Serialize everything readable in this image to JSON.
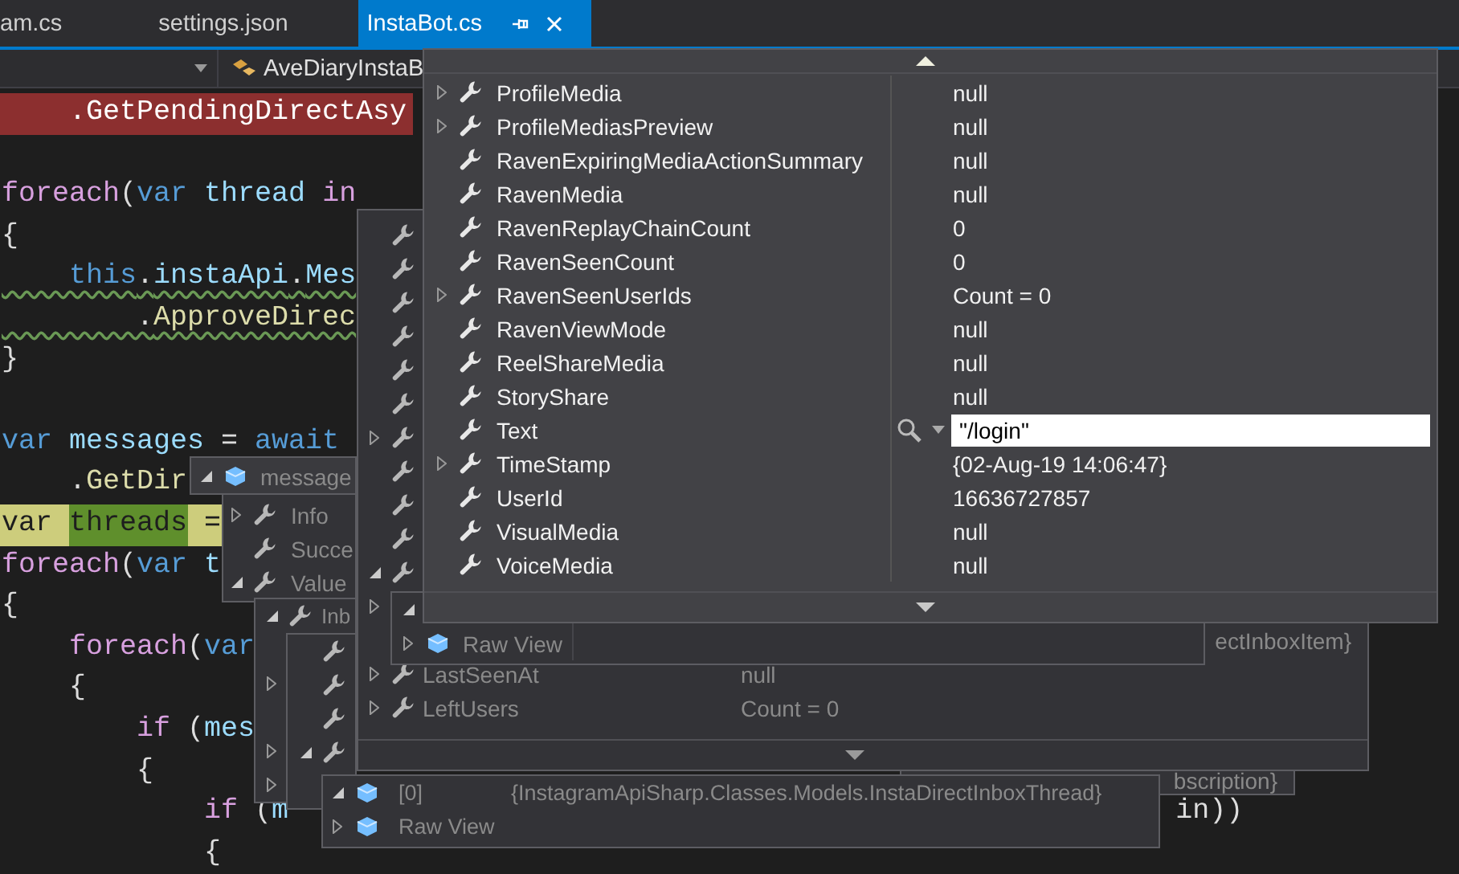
{
  "tabs": [
    {
      "label": "am.cs",
      "selected": false
    },
    {
      "label": "settings.json",
      "selected": false
    },
    {
      "label": "InstaBot.cs",
      "selected": true
    }
  ],
  "nav": {
    "member": "AveDiaryInstaB"
  },
  "code": [
    {
      "breakpoint": true,
      "current": false,
      "squiggle": false,
      "tokens": [
        {
          "text": "    .",
          "kind": "p"
        },
        {
          "text": "GetPendingDirectAsy",
          "kind": "fn"
        }
      ]
    },
    {
      "breakpoint": false,
      "current": false
    },
    {
      "breakpoint": false,
      "current": false,
      "squiggle": false,
      "tokens": [
        {
          "text": "foreach",
          "kind": "ctl"
        },
        {
          "text": "(",
          "kind": "p"
        },
        {
          "text": "var",
          "kind": "kw"
        },
        {
          "text": " thread",
          "kind": "id"
        },
        {
          "text": " in",
          "kind": "ctl"
        }
      ]
    },
    {
      "breakpoint": false,
      "current": false,
      "squiggle": false,
      "tokens": [
        {
          "text": "{",
          "kind": "p"
        }
      ]
    },
    {
      "breakpoint": false,
      "current": false,
      "squiggle": true,
      "tokens": [
        {
          "text": "    this",
          "kind": "kw"
        },
        {
          "text": ".",
          "kind": "p"
        },
        {
          "text": "instaApi",
          "kind": "id"
        },
        {
          "text": ".",
          "kind": "p"
        },
        {
          "text": "Mes",
          "kind": "id"
        }
      ]
    },
    {
      "breakpoint": false,
      "current": false,
      "squiggle": true,
      "tokens": [
        {
          "text": "        .",
          "kind": "p"
        },
        {
          "text": "ApproveDirec",
          "kind": "fn"
        }
      ]
    },
    {
      "breakpoint": false,
      "current": false,
      "squiggle": false,
      "tokens": [
        {
          "text": "}",
          "kind": "p"
        }
      ]
    },
    {
      "breakpoint": false,
      "current": false
    },
    {
      "breakpoint": false,
      "current": false,
      "squiggle": false,
      "tokens": [
        {
          "text": "var",
          "kind": "kw"
        },
        {
          "text": " messages",
          "kind": "id"
        },
        {
          "text": " = ",
          "kind": "p"
        },
        {
          "text": "await",
          "kind": "kw"
        }
      ]
    },
    {
      "breakpoint": false,
      "current": false,
      "squiggle": false,
      "tokens": [
        {
          "text": "    .",
          "kind": "p"
        },
        {
          "text": "GetDir",
          "kind": "fn"
        }
      ]
    },
    {
      "breakpoint": false,
      "current": true,
      "squiggle": false,
      "tokens": [
        {
          "text": "var ",
          "kind": "p"
        },
        {
          "text": "threads",
          "kind": "match"
        },
        {
          "text": " =",
          "kind": "p"
        }
      ]
    },
    {
      "breakpoint": false,
      "current": false,
      "squiggle": false,
      "tokens": [
        {
          "text": "foreach",
          "kind": "ctl"
        },
        {
          "text": "(",
          "kind": "p"
        },
        {
          "text": "var",
          "kind": "kw"
        },
        {
          "text": " t",
          "kind": "id"
        }
      ]
    },
    {
      "breakpoint": false,
      "current": false,
      "squiggle": false,
      "tokens": [
        {
          "text": "{",
          "kind": "p"
        }
      ]
    },
    {
      "breakpoint": false,
      "current": false,
      "squiggle": false,
      "tokens": [
        {
          "text": "    foreach",
          "kind": "ctl"
        },
        {
          "text": "(",
          "kind": "p"
        },
        {
          "text": "var",
          "kind": "kw"
        }
      ]
    },
    {
      "breakpoint": false,
      "current": false,
      "squiggle": false,
      "tokens": [
        {
          "text": "    {",
          "kind": "p"
        }
      ]
    },
    {
      "breakpoint": false,
      "current": false,
      "squiggle": false,
      "tokens": [
        {
          "text": "        if",
          "kind": "ctl"
        },
        {
          "text": " (",
          "kind": "p"
        },
        {
          "text": "mes",
          "kind": "id"
        }
      ]
    },
    {
      "breakpoint": false,
      "current": false,
      "squiggle": false,
      "tokens": [
        {
          "text": "        {",
          "kind": "p"
        }
      ]
    },
    {
      "breakpoint": false,
      "current": false,
      "squiggle": false,
      "tokens": [
        {
          "text": "            if",
          "kind": "ctl"
        },
        {
          "text": " (",
          "kind": "p"
        },
        {
          "text": "m",
          "kind": "id"
        }
      ],
      "tail": "in))"
    },
    {
      "breakpoint": false,
      "current": false,
      "squiggle": false,
      "tokens": [
        {
          "text": "            {",
          "kind": "p"
        }
      ]
    }
  ],
  "datatips": [
    {
      "kind": "head",
      "active": false,
      "rows": [
        {
          "kind": "object",
          "expanded": true,
          "name": "message"
        }
      ]
    },
    {
      "kind": "messages",
      "active": false,
      "rows": [
        {
          "kind": "property",
          "expanded": false,
          "name": "Info"
        },
        {
          "kind": "property",
          "name": "Succe"
        },
        {
          "kind": "property",
          "expanded": true,
          "name": "Value"
        }
      ]
    },
    {
      "kind": "inbox",
      "active": false,
      "rows": [
        {
          "kind": "property",
          "expanded": true,
          "name": "Inb"
        },
        {
          "kind": "hidden"
        },
        {
          "kind": "hidden",
          "expanded": false
        },
        {
          "kind": "hidden"
        },
        {
          "kind": "hidden",
          "expanded": false
        },
        {
          "kind": "hidden",
          "expanded": false
        }
      ]
    },
    {
      "kind": "inner",
      "active": false,
      "rows": [
        {
          "kind": "property"
        },
        {
          "kind": "property"
        },
        {
          "kind": "property"
        },
        {
          "kind": "property",
          "expanded": true
        }
      ]
    },
    {
      "kind": "partial",
      "active": false,
      "rows": [
        {
          "kind": "hidden",
          "value": "bscription}"
        }
      ]
    },
    {
      "kind": "back",
      "active": false,
      "rows": [
        {
          "kind": "property"
        },
        {
          "kind": "property"
        },
        {
          "kind": "property"
        },
        {
          "kind": "property"
        },
        {
          "kind": "property"
        },
        {
          "kind": "property"
        },
        {
          "kind": "property",
          "expanded": false
        },
        {
          "kind": "property"
        },
        {
          "kind": "property"
        },
        {
          "kind": "property"
        },
        {
          "kind": "property",
          "expanded": true
        },
        {
          "kind": "hidden",
          "expanded": false
        },
        {
          "kind": "hidden",
          "value": "ectInboxItem}"
        },
        {
          "kind": "property",
          "expanded": false,
          "name": "LastSeenAt",
          "value": "null"
        },
        {
          "kind": "property",
          "expanded": false,
          "name": "LeftUsers",
          "value": "Count = 0"
        }
      ]
    },
    {
      "kind": "raw",
      "active": false,
      "rows": [
        {
          "kind": "hidden",
          "expanded": true
        },
        {
          "kind": "object",
          "expanded": false,
          "name": "Raw View"
        }
      ]
    },
    {
      "kind": "item",
      "active": false,
      "rows": [
        {
          "kind": "object",
          "expanded": true,
          "name": "[0]",
          "value": "{InstagramApiSharp.Classes.Models.InstaDirectInboxThread}"
        },
        {
          "kind": "object",
          "expanded": false,
          "name": "Raw View"
        }
      ]
    },
    {
      "kind": "main",
      "active": true,
      "rows": [
        {
          "kind": "property",
          "expanded": false,
          "name": "ProfileMedia",
          "value": "null",
          "editing": false
        },
        {
          "kind": "property",
          "expanded": false,
          "name": "ProfileMediasPreview",
          "value": "null",
          "editing": false
        },
        {
          "kind": "property",
          "name": "RavenExpiringMediaActionSummary",
          "value": "null",
          "editing": false
        },
        {
          "kind": "property",
          "name": "RavenMedia",
          "value": "null",
          "editing": false
        },
        {
          "kind": "property",
          "name": "RavenReplayChainCount",
          "value": "0",
          "editing": false
        },
        {
          "kind": "property",
          "name": "RavenSeenCount",
          "value": "0",
          "editing": false
        },
        {
          "kind": "property",
          "expanded": false,
          "name": "RavenSeenUserIds",
          "value": "Count = 0",
          "editing": false
        },
        {
          "kind": "property",
          "name": "RavenViewMode",
          "value": "null",
          "editing": false
        },
        {
          "kind": "property",
          "name": "ReelShareMedia",
          "value": "null",
          "editing": false
        },
        {
          "kind": "property",
          "name": "StoryShare",
          "value": "null",
          "editing": false
        },
        {
          "kind": "property",
          "name": "Text",
          "value": "\"/login\"",
          "editing": true
        },
        {
          "kind": "property",
          "expanded": false,
          "name": "TimeStamp",
          "value": "{02-Aug-19 14:06:47}",
          "editing": false
        },
        {
          "kind": "property",
          "name": "UserId",
          "value": "16636727857",
          "editing": false
        },
        {
          "kind": "property",
          "name": "VisualMedia",
          "value": "null",
          "editing": false
        },
        {
          "kind": "property",
          "name": "VoiceMedia",
          "value": "null",
          "editing": false
        }
      ]
    }
  ]
}
